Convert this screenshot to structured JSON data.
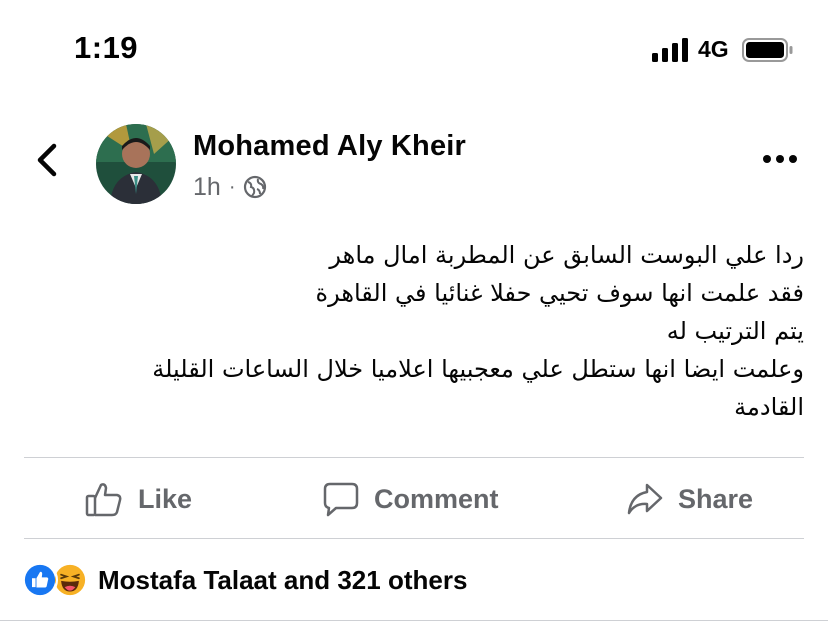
{
  "status_bar": {
    "time": "1:19",
    "network": "4G",
    "icons": [
      "signal-bars-icon",
      "battery-icon"
    ]
  },
  "post": {
    "author": "Mohamed Aly Kheir",
    "time": "1h",
    "dot": "·",
    "privacy_icon": "globe-icon",
    "lines": [
      "ردا علي البوست السابق عن المطربة امال ماهر",
      "فقد علمت انها سوف تحيي حفلا غنائيا في القاهرة",
      "يتم الترتيب له",
      "وعلمت ايضا انها ستطل علي معجبيها  اعلاميا خلال الساعات القليلة",
      "القادمة"
    ]
  },
  "actions": {
    "like": "Like",
    "comment": "Comment",
    "share": "Share"
  },
  "reactions": {
    "summary": "Mostafa Talaat and 321 others",
    "icons": [
      "like-reaction-icon",
      "haha-reaction-icon"
    ]
  },
  "colors": {
    "text": "#050505",
    "secondary": "#65676b",
    "like_blue": "#1877f2",
    "haha_yellow": "#f7b125",
    "divider": "#ced0d4"
  }
}
